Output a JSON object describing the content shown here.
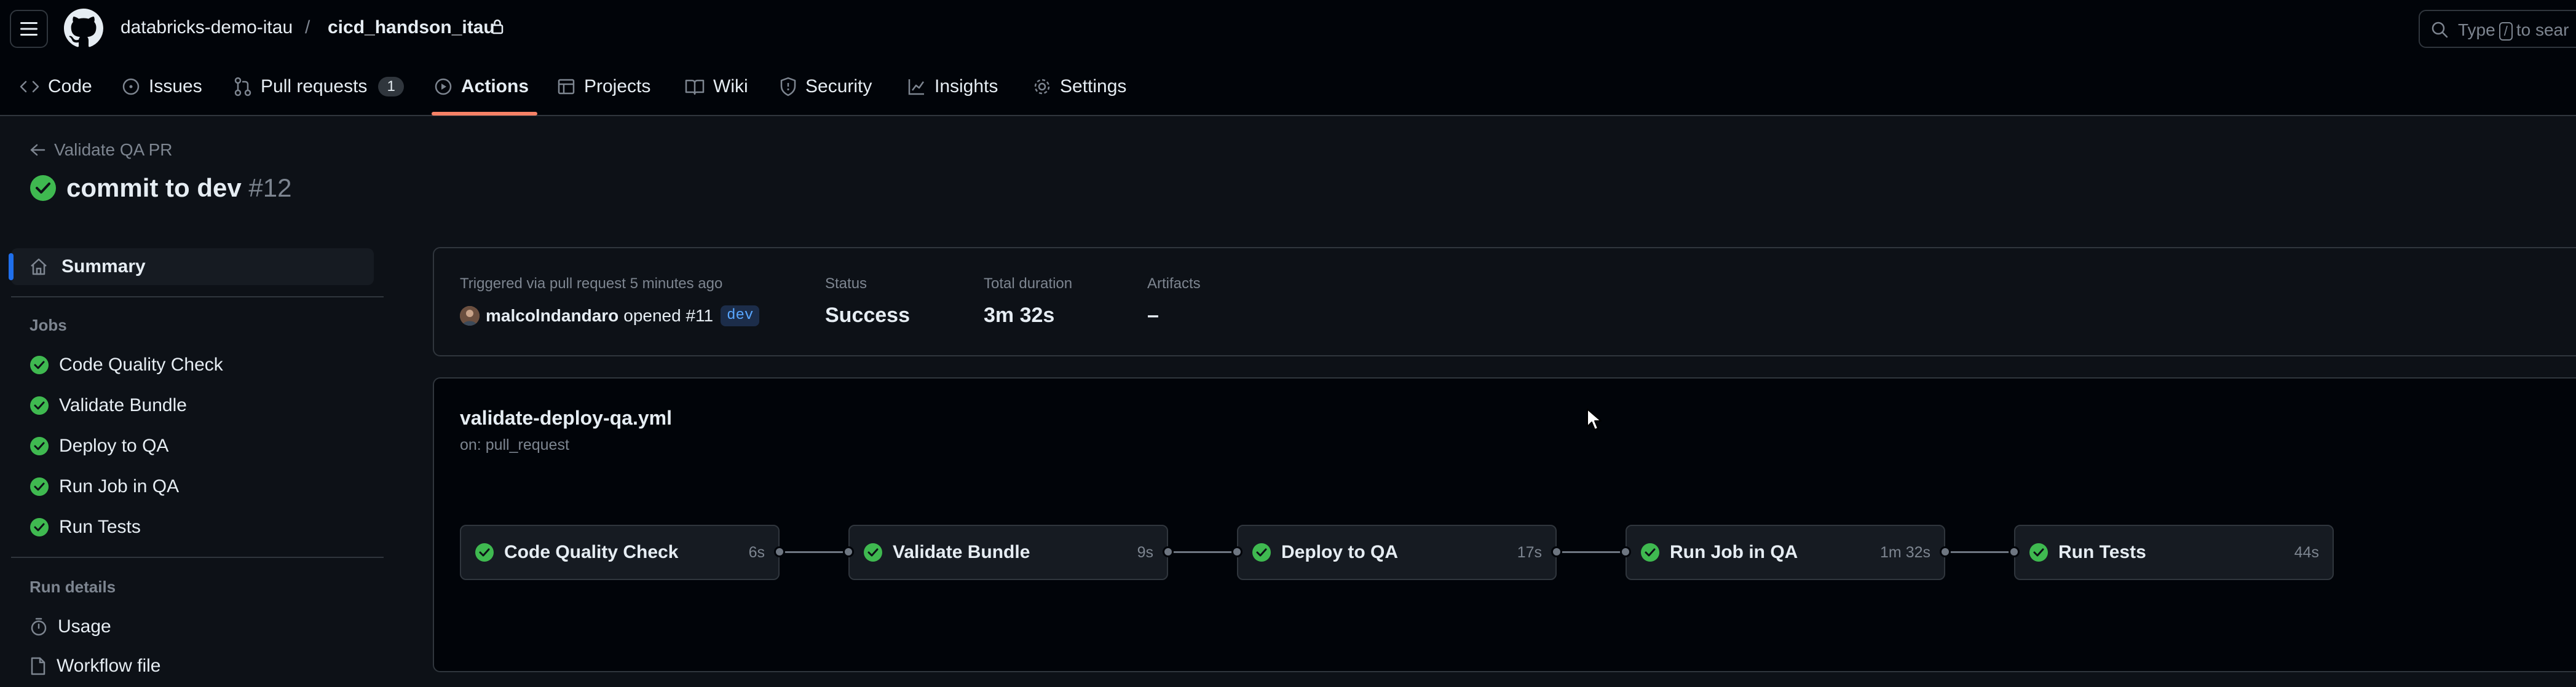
{
  "header": {
    "owner": "databricks-demo-itau",
    "separator": "/",
    "repo": "cicd_handson_itau",
    "search": {
      "prefix": "Type",
      "key": "/",
      "suffix": "to sear"
    }
  },
  "tabs": [
    {
      "label": "Code",
      "icon": "code-icon"
    },
    {
      "label": "Issues",
      "icon": "issue-icon"
    },
    {
      "label": "Pull requests",
      "icon": "pull-request-icon",
      "count": "1"
    },
    {
      "label": "Actions",
      "icon": "play-icon",
      "active": true
    },
    {
      "label": "Projects",
      "icon": "table-icon"
    },
    {
      "label": "Wiki",
      "icon": "book-icon"
    },
    {
      "label": "Security",
      "icon": "shield-icon"
    },
    {
      "label": "Insights",
      "icon": "graph-icon"
    },
    {
      "label": "Settings",
      "icon": "gear-icon"
    }
  ],
  "run": {
    "back_label": "Validate QA PR",
    "title": "commit to dev",
    "number": "#12",
    "status_color": "#3fb950"
  },
  "sidebar": {
    "summary_label": "Summary",
    "jobs_heading": "Jobs",
    "jobs": [
      "Code Quality Check",
      "Validate Bundle",
      "Deploy to QA",
      "Run Job in QA",
      "Run Tests"
    ],
    "run_details_heading": "Run details",
    "details": [
      {
        "label": "Usage",
        "icon": "stopwatch-icon"
      },
      {
        "label": "Workflow file",
        "icon": "file-icon"
      }
    ]
  },
  "summary": {
    "trigger_label": "Triggered via pull request 5 minutes ago",
    "user": "malcolndandaro",
    "action": "opened #11",
    "branch": "dev",
    "status_label": "Status",
    "status_value": "Success",
    "duration_label": "Total duration",
    "duration_value": "3m 32s",
    "artifacts_label": "Artifacts",
    "artifacts_value": "–"
  },
  "workflow": {
    "file": "validate-deploy-qa.yml",
    "trigger": "on: pull_request",
    "jobs": [
      {
        "name": "Code Quality Check",
        "duration": "6s"
      },
      {
        "name": "Validate Bundle",
        "duration": "9s"
      },
      {
        "name": "Deploy to QA",
        "duration": "17s"
      },
      {
        "name": "Run Job in QA",
        "duration": "1m 32s"
      },
      {
        "name": "Run Tests",
        "duration": "44s"
      }
    ]
  },
  "colors": {
    "success": "#3fb950",
    "accent_tab": "#f78166",
    "active_nav": "#1f6feb",
    "background": "#0d1117"
  }
}
